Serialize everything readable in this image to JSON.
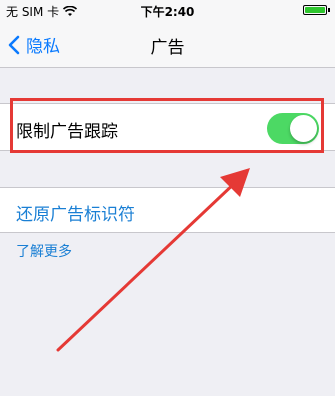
{
  "status_bar": {
    "carrier": "无 SIM 卡",
    "time": "下午2:40",
    "battery_color": "#2ec52e"
  },
  "nav": {
    "back_label": "隐私",
    "title": "广告",
    "accent_color": "#0a7afe"
  },
  "settings": {
    "limit_ad_tracking": {
      "label": "限制广告跟踪",
      "enabled": true
    },
    "reset_identifier_label": "还原广告标识符",
    "learn_more_label": "了解更多"
  },
  "annotation": {
    "highlight_color": "#e53935"
  }
}
